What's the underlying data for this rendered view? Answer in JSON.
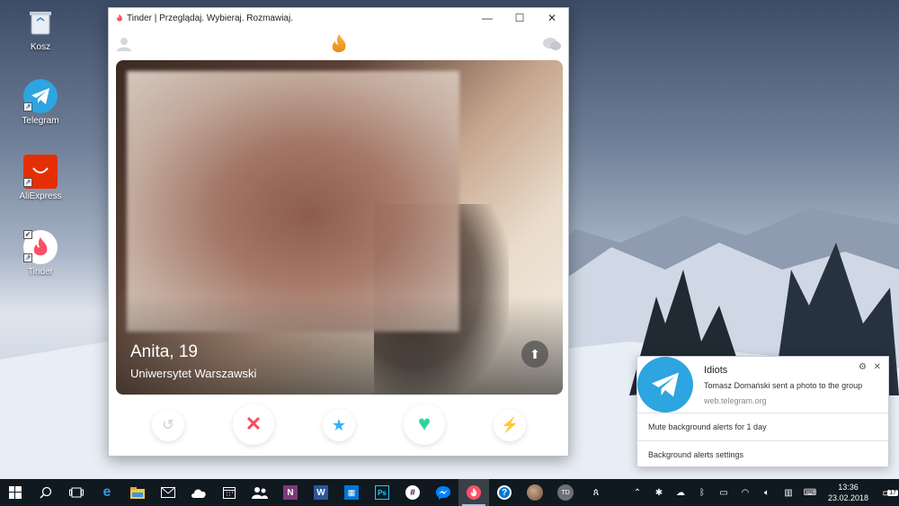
{
  "desktop": {
    "icons": [
      {
        "label": "Kosz",
        "icon": "recycle-bin-icon"
      },
      {
        "label": "Telegram",
        "icon": "telegram-icon"
      },
      {
        "label": "AliExpress",
        "icon": "aliexpress-icon"
      },
      {
        "label": "Tinder",
        "icon": "tinder-icon"
      }
    ]
  },
  "window": {
    "title": "Tinder | Przeglądaj. Wybieraj. Rozmawiaj.",
    "controls": {
      "minimize": "—",
      "maximize": "☐",
      "close": "✕"
    }
  },
  "profile": {
    "name": "Anita, 19",
    "school": "Uniwersytet Warszawski"
  },
  "actions": [
    {
      "name": "rewind-button",
      "icon": "rewind-icon",
      "glyph": "↺",
      "color": "#cfcfcf"
    },
    {
      "name": "nope-button",
      "icon": "x-icon",
      "glyph": "✕",
      "color": "#fd4a5c"
    },
    {
      "name": "super-like-button",
      "icon": "star-icon",
      "glyph": "★",
      "color": "#2db4f6"
    },
    {
      "name": "like-button",
      "icon": "heart-icon",
      "glyph": "♥",
      "color": "#29d6a1"
    },
    {
      "name": "boost-button",
      "icon": "lightning-icon",
      "glyph": "⚡",
      "color": "#a24ff2"
    }
  ],
  "notification": {
    "title": "Idiots",
    "body": "Tomasz Domański sent a photo to the group",
    "source": "web.telegram.org",
    "settings_glyph": "⚙",
    "close_glyph": "✕",
    "mute": "Mute background alerts for 1 day",
    "settings": "Background alerts settings"
  },
  "taskbar": {
    "user_initials": "TD",
    "time": "13:36",
    "date": "23.02.2018",
    "notification_count": "17"
  },
  "colors": {
    "tinder_accent": "#fd5068",
    "telegram_blue": "#2ca5e0",
    "taskbar_bg": "#101820"
  }
}
